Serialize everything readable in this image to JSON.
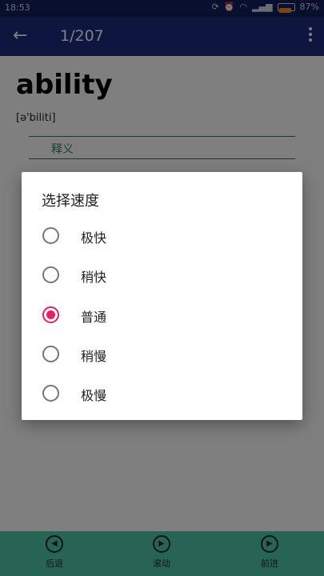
{
  "status_bar": {
    "time": "18:53",
    "battery_text": "87%",
    "battery_level": 0.87,
    "icons": [
      "sync-icon",
      "alarm-icon",
      "wifi-icon",
      "signal-icon",
      "battery-icon"
    ]
  },
  "app_bar": {
    "title": "1/207",
    "back_icon": "arrow-left-icon",
    "menu_icon": "more-vert-icon"
  },
  "word": {
    "text": "ability",
    "phonetic": "[ə'biliti]",
    "meaning_label": "释义"
  },
  "bottom_nav": [
    {
      "label": "后退",
      "icon": "rewind-icon"
    },
    {
      "label": "滚动",
      "icon": "play-icon"
    },
    {
      "label": "前进",
      "icon": "forward-icon"
    }
  ],
  "dialog": {
    "title": "选择速度",
    "options": [
      {
        "label": "极快",
        "checked": false
      },
      {
        "label": "稍快",
        "checked": false
      },
      {
        "label": "普通",
        "checked": true
      },
      {
        "label": "稍慢",
        "checked": false
      },
      {
        "label": "极慢",
        "checked": false
      }
    ]
  },
  "colors": {
    "app_bar": "#1d2a7e",
    "status_bar": "#111e5f",
    "bottom_bar": "#4fc9aa",
    "accent": "#e91e63",
    "meaning_teal": "#1f7f6e"
  }
}
